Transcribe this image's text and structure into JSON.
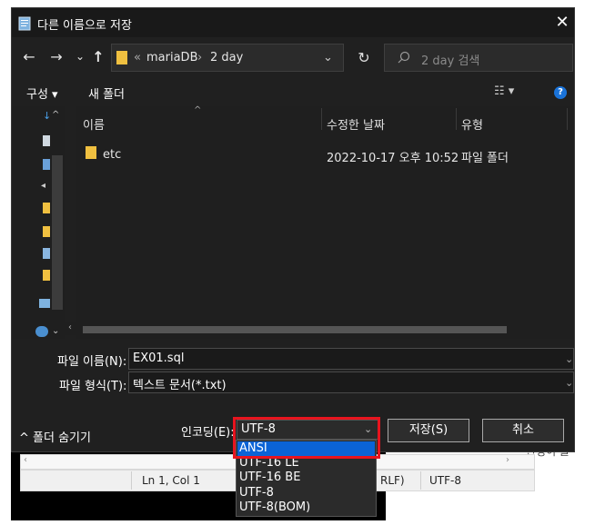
{
  "window": {
    "title": "다른 이름으로 저장",
    "close_glyph": "✕"
  },
  "nav": {
    "back_glyph": "←",
    "forward_glyph": "→",
    "recent_glyph": "⌄",
    "up_glyph": "↑",
    "breadcrumb_sep": "«",
    "path": [
      "mariaDB",
      "2 day"
    ],
    "path_arrow": "›",
    "address_chevron": "⌄",
    "refresh_glyph": "↻",
    "search_placeholder": "2 day 검색"
  },
  "toolbar": {
    "organize_label": "구성 ▾",
    "new_folder_label": "새 폴더",
    "view_glyph": "☷ ▾",
    "help_glyph": "?"
  },
  "columns": {
    "name": "이름",
    "modified": "수정한 날짜",
    "type": "유형"
  },
  "files": [
    {
      "name": "etc",
      "modified": "2022-10-17 오후 10:52",
      "type": "파일 폴더"
    }
  ],
  "form": {
    "filename_label": "파일 이름(N):",
    "filename_value": "EX01.sql",
    "filetype_label": "파일 형식(T):",
    "filetype_value": "텍스트 문서(*.txt)",
    "hide_folders_label": "^  폴더 숨기기",
    "encoding_label": "인코딩(E):",
    "encoding_value": "UTF-8",
    "save_label": "저장(S)",
    "cancel_label": "취소"
  },
  "encoding_options": [
    "ANSI",
    "UTF-16 LE",
    "UTF-16 BE",
    "UTF-8",
    "UTF-8(BOM)"
  ],
  "encoding_selected_index": 0,
  "notepad": {
    "position": "Ln 1, Col 1",
    "line_ending_fragment": "RLF)",
    "encoding": "UTF-8",
    "bg_text": "관정이 늘"
  },
  "colors": {
    "highlight": "#e8141e",
    "selection": "#0b63d6",
    "folder": "#f0c040"
  }
}
